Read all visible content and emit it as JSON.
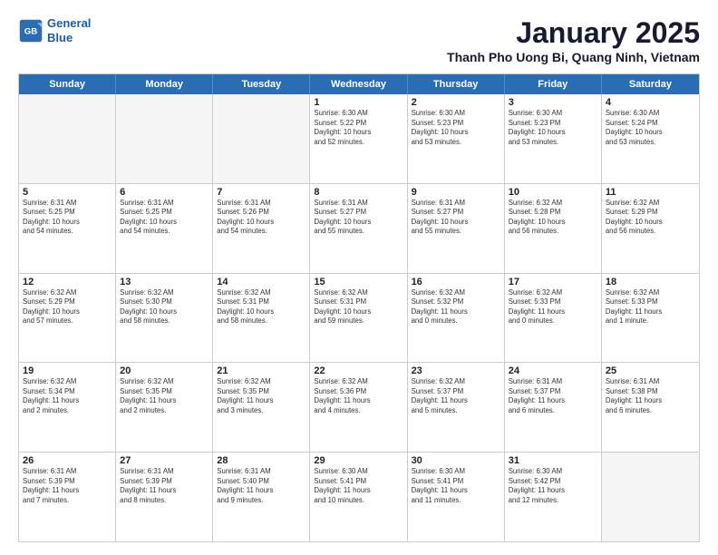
{
  "logo": {
    "line1": "General",
    "line2": "Blue"
  },
  "title": "January 2025",
  "location": "Thanh Pho Uong Bi, Quang Ninh, Vietnam",
  "header": {
    "days": [
      "Sunday",
      "Monday",
      "Tuesday",
      "Wednesday",
      "Thursday",
      "Friday",
      "Saturday"
    ]
  },
  "rows": [
    [
      {
        "day": "",
        "info": "",
        "empty": true
      },
      {
        "day": "",
        "info": "",
        "empty": true
      },
      {
        "day": "",
        "info": "",
        "empty": true
      },
      {
        "day": "1",
        "info": "Sunrise: 6:30 AM\nSunset: 5:22 PM\nDaylight: 10 hours\nand 52 minutes."
      },
      {
        "day": "2",
        "info": "Sunrise: 6:30 AM\nSunset: 5:23 PM\nDaylight: 10 hours\nand 53 minutes."
      },
      {
        "day": "3",
        "info": "Sunrise: 6:30 AM\nSunset: 5:23 PM\nDaylight: 10 hours\nand 53 minutes."
      },
      {
        "day": "4",
        "info": "Sunrise: 6:30 AM\nSunset: 5:24 PM\nDaylight: 10 hours\nand 53 minutes."
      }
    ],
    [
      {
        "day": "5",
        "info": "Sunrise: 6:31 AM\nSunset: 5:25 PM\nDaylight: 10 hours\nand 54 minutes."
      },
      {
        "day": "6",
        "info": "Sunrise: 6:31 AM\nSunset: 5:25 PM\nDaylight: 10 hours\nand 54 minutes."
      },
      {
        "day": "7",
        "info": "Sunrise: 6:31 AM\nSunset: 5:26 PM\nDaylight: 10 hours\nand 54 minutes."
      },
      {
        "day": "8",
        "info": "Sunrise: 6:31 AM\nSunset: 5:27 PM\nDaylight: 10 hours\nand 55 minutes."
      },
      {
        "day": "9",
        "info": "Sunrise: 6:31 AM\nSunset: 5:27 PM\nDaylight: 10 hours\nand 55 minutes."
      },
      {
        "day": "10",
        "info": "Sunrise: 6:32 AM\nSunset: 5:28 PM\nDaylight: 10 hours\nand 56 minutes."
      },
      {
        "day": "11",
        "info": "Sunrise: 6:32 AM\nSunset: 5:29 PM\nDaylight: 10 hours\nand 56 minutes."
      }
    ],
    [
      {
        "day": "12",
        "info": "Sunrise: 6:32 AM\nSunset: 5:29 PM\nDaylight: 10 hours\nand 57 minutes."
      },
      {
        "day": "13",
        "info": "Sunrise: 6:32 AM\nSunset: 5:30 PM\nDaylight: 10 hours\nand 58 minutes."
      },
      {
        "day": "14",
        "info": "Sunrise: 6:32 AM\nSunset: 5:31 PM\nDaylight: 10 hours\nand 58 minutes."
      },
      {
        "day": "15",
        "info": "Sunrise: 6:32 AM\nSunset: 5:31 PM\nDaylight: 10 hours\nand 59 minutes."
      },
      {
        "day": "16",
        "info": "Sunrise: 6:32 AM\nSunset: 5:32 PM\nDaylight: 11 hours\nand 0 minutes."
      },
      {
        "day": "17",
        "info": "Sunrise: 6:32 AM\nSunset: 5:33 PM\nDaylight: 11 hours\nand 0 minutes."
      },
      {
        "day": "18",
        "info": "Sunrise: 6:32 AM\nSunset: 5:33 PM\nDaylight: 11 hours\nand 1 minute."
      }
    ],
    [
      {
        "day": "19",
        "info": "Sunrise: 6:32 AM\nSunset: 5:34 PM\nDaylight: 11 hours\nand 2 minutes."
      },
      {
        "day": "20",
        "info": "Sunrise: 6:32 AM\nSunset: 5:35 PM\nDaylight: 11 hours\nand 2 minutes."
      },
      {
        "day": "21",
        "info": "Sunrise: 6:32 AM\nSunset: 5:35 PM\nDaylight: 11 hours\nand 3 minutes."
      },
      {
        "day": "22",
        "info": "Sunrise: 6:32 AM\nSunset: 5:36 PM\nDaylight: 11 hours\nand 4 minutes."
      },
      {
        "day": "23",
        "info": "Sunrise: 6:32 AM\nSunset: 5:37 PM\nDaylight: 11 hours\nand 5 minutes."
      },
      {
        "day": "24",
        "info": "Sunrise: 6:31 AM\nSunset: 5:37 PM\nDaylight: 11 hours\nand 6 minutes."
      },
      {
        "day": "25",
        "info": "Sunrise: 6:31 AM\nSunset: 5:38 PM\nDaylight: 11 hours\nand 6 minutes."
      }
    ],
    [
      {
        "day": "26",
        "info": "Sunrise: 6:31 AM\nSunset: 5:39 PM\nDaylight: 11 hours\nand 7 minutes."
      },
      {
        "day": "27",
        "info": "Sunrise: 6:31 AM\nSunset: 5:39 PM\nDaylight: 11 hours\nand 8 minutes."
      },
      {
        "day": "28",
        "info": "Sunrise: 6:31 AM\nSunset: 5:40 PM\nDaylight: 11 hours\nand 9 minutes."
      },
      {
        "day": "29",
        "info": "Sunrise: 6:30 AM\nSunset: 5:41 PM\nDaylight: 11 hours\nand 10 minutes."
      },
      {
        "day": "30",
        "info": "Sunrise: 6:30 AM\nSunset: 5:41 PM\nDaylight: 11 hours\nand 11 minutes."
      },
      {
        "day": "31",
        "info": "Sunrise: 6:30 AM\nSunset: 5:42 PM\nDaylight: 11 hours\nand 12 minutes."
      },
      {
        "day": "",
        "info": "",
        "empty": true
      }
    ]
  ]
}
